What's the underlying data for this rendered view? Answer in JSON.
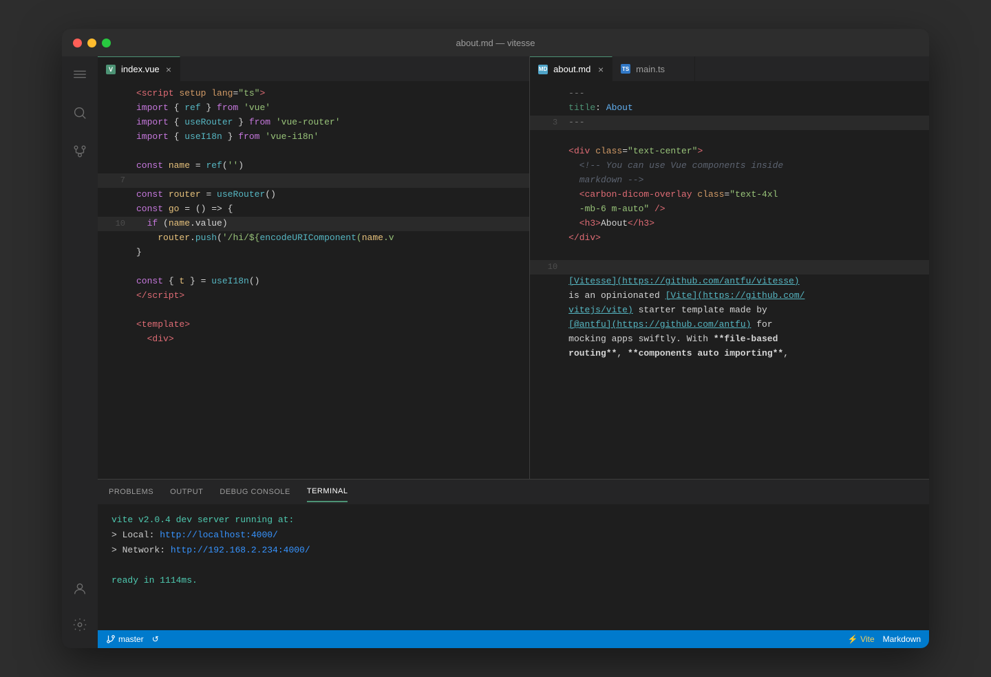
{
  "window": {
    "title": "about.md — vitesse"
  },
  "traffic_lights": {
    "close_label": "close",
    "minimize_label": "minimize",
    "maximize_label": "maximize"
  },
  "left_editor": {
    "tab": {
      "icon_type": "vue",
      "icon_label": "V",
      "filename": "index.vue",
      "close_label": "×"
    },
    "lines": [
      {
        "num": "",
        "content_html": "<span class='c-tag'>&lt;script</span> <span class='c-attr'>setup</span> <span class='c-attr'>lang</span>=<span class='c-string'>\"ts\"</span><span class='c-tag'>&gt;</span>"
      },
      {
        "num": "",
        "content_html": "<span class='c-keyword'>import</span> { <span class='c-teal'>ref</span> } <span class='c-keyword'>from</span> <span class='c-string'>'vue'</span>"
      },
      {
        "num": "",
        "content_html": "<span class='c-keyword'>import</span> { <span class='c-teal'>useRouter</span> } <span class='c-keyword'>from</span> <span class='c-string'>'vue-router'</span>"
      },
      {
        "num": "",
        "content_html": "<span class='c-keyword'>import</span> { <span class='c-teal'>useI18n</span> } <span class='c-keyword'>from</span> <span class='c-string'>'vue-i18n'</span>"
      },
      {
        "num": "",
        "content_html": ""
      },
      {
        "num": "",
        "content_html": "<span class='c-keyword'>const</span> <span class='c-var'>name</span> = <span class='c-teal'>ref</span>(<span class='c-string'>''</span>)"
      },
      {
        "num": "7",
        "content_html": "",
        "highlighted": true
      },
      {
        "num": "",
        "content_html": "<span class='c-keyword'>const</span> <span class='c-var'>router</span> = <span class='c-teal'>useRouter</span>()"
      },
      {
        "num": "",
        "content_html": "<span class='c-keyword'>const</span> <span class='c-var'>go</span> = () => {"
      },
      {
        "num": "10",
        "content_html": "  <span class='c-keyword'>if</span> (<span class='c-var'>name</span>.value)",
        "highlighted": true
      },
      {
        "num": "",
        "content_html": "    <span class='c-var'>router</span>.<span class='c-teal'>push</span>(<span class='c-string'>'/hi/$&#123;<span class='c-teal'>encodeURIComponent</span>(<span class='c-var'>name</span>.v</span>"
      },
      {
        "num": "",
        "content_html": "}"
      },
      {
        "num": "",
        "content_html": ""
      },
      {
        "num": "",
        "content_html": "<span class='c-keyword'>const</span> { <span class='c-var'>t</span> } = <span class='c-teal'>useI18n</span>()"
      },
      {
        "num": "",
        "content_html": "<span class='c-tag'>&lt;/script&gt;</span>"
      },
      {
        "num": "",
        "content_html": ""
      },
      {
        "num": "",
        "content_html": "<span class='c-tag'>&lt;template&gt;</span>"
      },
      {
        "num": "",
        "content_html": "  <span class='c-tag'>&lt;div&gt;</span>"
      }
    ]
  },
  "right_editor": {
    "tabs": [
      {
        "icon_type": "md",
        "icon_label": "M",
        "filename": "about.md",
        "active": true,
        "close_label": "×"
      },
      {
        "icon_type": "ts",
        "icon_label": "TS",
        "filename": "main.ts",
        "active": false
      }
    ],
    "lines": [
      {
        "num": "",
        "content_html": "<span class='c-gray'>---</span>"
      },
      {
        "num": "",
        "content_html": "<span class='c-green'>title</span>: <span class='c-blue'>About</span>"
      },
      {
        "num": "3",
        "content_html": "<span class='c-gray'>---</span>",
        "highlighted": true
      },
      {
        "num": "",
        "content_html": ""
      },
      {
        "num": "",
        "content_html": "<span class='c-tag'>&lt;div</span> <span class='c-attr'>class</span>=<span class='c-string'>\"text-center\"</span><span class='c-tag'>&gt;</span>"
      },
      {
        "num": "",
        "content_html": "  <span class='c-comment'>&lt;!-- You can use Vue components inside</span>"
      },
      {
        "num": "",
        "content_html": "  <span class='c-comment'>markdown --&gt;</span>"
      },
      {
        "num": "",
        "content_html": "  <span class='c-tag'>&lt;carbon-dicom-overlay</span> <span class='c-attr'>class</span>=<span class='c-string'>\"text-4xl</span>"
      },
      {
        "num": "",
        "content_html": "  <span class='c-string'>-mb-6 m-auto\"</span> <span class='c-tag'>/&gt;</span>"
      },
      {
        "num": "",
        "content_html": "  <span class='c-tag'>&lt;h3&gt;</span>About<span class='c-tag'>&lt;/h3&gt;</span>"
      },
      {
        "num": "",
        "content_html": "<span class='c-tag'>&lt;/div&gt;</span>"
      },
      {
        "num": "",
        "content_html": ""
      },
      {
        "num": "10",
        "content_html": "",
        "highlighted": true
      },
      {
        "num": "",
        "content_html": "<span class='c-link'>[Vitesse](https://github.com/antfu/vitesse)</span>"
      },
      {
        "num": "",
        "content_html": "is an opinionated <span class='c-link'>[Vite](https://github.com/</span>"
      },
      {
        "num": "",
        "content_html": "<span class='c-link'>vitejs/vite)</span> starter template made by"
      },
      {
        "num": "",
        "content_html": "<span class='c-link'>[@antfu](https://github.com/antfu)</span> for"
      },
      {
        "num": "",
        "content_html": "mocking apps swiftly. With <span class='c-bold'>**file-based</span>"
      },
      {
        "num": "",
        "content_html": "<span class='c-bold'>routing**</span>, <span class='c-bold'>**components auto importing**</span>,"
      }
    ]
  },
  "panel": {
    "tabs": [
      "PROBLEMS",
      "OUTPUT",
      "DEBUG CONSOLE",
      "TERMINAL"
    ],
    "active_tab": "TERMINAL",
    "terminal": {
      "line1": "vite v2.0.4 dev server running at:",
      "line2": "> Local:    http://localhost:4000/",
      "line3": "> Network:  http://192.168.2.234:4000/",
      "line4": "",
      "line5": "ready in 1114ms."
    }
  },
  "status_bar": {
    "branch": "master",
    "sync_label": "↺",
    "vite_label": "⚡ Vite",
    "language_label": "Markdown"
  }
}
